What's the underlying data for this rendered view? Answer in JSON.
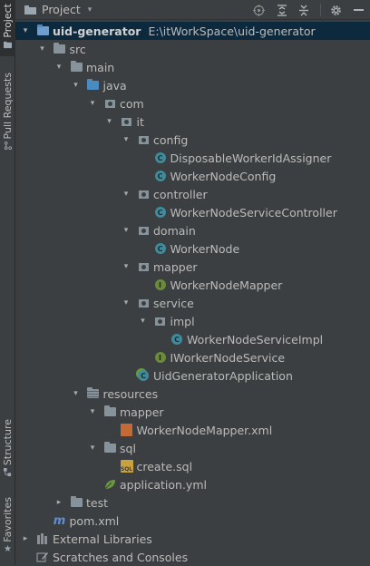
{
  "side_tabs": {
    "project": "Project",
    "pull_requests": "Pull Requests",
    "structure": "Structure",
    "favorites": "Favorites"
  },
  "header": {
    "title": "Project",
    "caret": "▾",
    "icons": [
      "locate-icon",
      "expand-all-icon",
      "collapse-all-icon",
      "settings-icon",
      "hide-icon"
    ]
  },
  "tree": [
    {
      "label": "uid-generator",
      "path": "E:\\itWorkSpace\\uid-generator",
      "depth": 0,
      "state": "open",
      "icon": "module-folder",
      "bold": true,
      "selected": true
    },
    {
      "label": "src",
      "depth": 1,
      "state": "open",
      "icon": "folder"
    },
    {
      "label": "main",
      "depth": 2,
      "state": "open",
      "icon": "folder"
    },
    {
      "label": "java",
      "depth": 3,
      "state": "open",
      "icon": "source-folder"
    },
    {
      "label": "com",
      "depth": 4,
      "state": "open",
      "icon": "package"
    },
    {
      "label": "it",
      "depth": 5,
      "state": "open",
      "icon": "package"
    },
    {
      "label": "config",
      "depth": 6,
      "state": "open",
      "icon": "package"
    },
    {
      "label": "DisposableWorkerIdAssigner",
      "depth": 7,
      "state": "leaf",
      "icon": "class"
    },
    {
      "label": "WorkerNodeConfig",
      "depth": 7,
      "state": "leaf",
      "icon": "class"
    },
    {
      "label": "controller",
      "depth": 6,
      "state": "open",
      "icon": "package"
    },
    {
      "label": "WorkerNodeServiceController",
      "depth": 7,
      "state": "leaf",
      "icon": "class"
    },
    {
      "label": "domain",
      "depth": 6,
      "state": "open",
      "icon": "package"
    },
    {
      "label": "WorkerNode",
      "depth": 7,
      "state": "leaf",
      "icon": "class"
    },
    {
      "label": "mapper",
      "depth": 6,
      "state": "open",
      "icon": "package"
    },
    {
      "label": "WorkerNodeMapper",
      "depth": 7,
      "state": "leaf",
      "icon": "interface"
    },
    {
      "label": "service",
      "depth": 6,
      "state": "open",
      "icon": "package"
    },
    {
      "label": "impl",
      "depth": 7,
      "state": "open",
      "icon": "package"
    },
    {
      "label": "WorkerNodeServiceImpl",
      "depth": 8,
      "state": "leaf",
      "icon": "class"
    },
    {
      "label": "IWorkerNodeService",
      "depth": 7,
      "state": "leaf",
      "icon": "interface"
    },
    {
      "label": "UidGeneratorApplication",
      "depth": 6,
      "state": "leaf",
      "icon": "spring-class"
    },
    {
      "label": "resources",
      "depth": 3,
      "state": "open",
      "icon": "resources-folder"
    },
    {
      "label": "mapper",
      "depth": 4,
      "state": "open",
      "icon": "folder"
    },
    {
      "label": "WorkerNodeMapper.xml",
      "depth": 5,
      "state": "leaf",
      "icon": "xml-file"
    },
    {
      "label": "sql",
      "depth": 4,
      "state": "open",
      "icon": "folder"
    },
    {
      "label": "create.sql",
      "depth": 5,
      "state": "leaf",
      "icon": "sql-file"
    },
    {
      "label": "application.yml",
      "depth": 4,
      "state": "leaf",
      "icon": "yml-file"
    },
    {
      "label": "test",
      "depth": 2,
      "state": "closed",
      "icon": "folder"
    },
    {
      "label": "pom.xml",
      "depth": 1,
      "state": "leaf",
      "icon": "maven-file"
    },
    {
      "label": "External Libraries",
      "depth": 0,
      "state": "closed",
      "icon": "libraries"
    },
    {
      "label": "Scratches and Consoles",
      "depth": 0,
      "state": "leaf",
      "icon": "scratches"
    }
  ],
  "glyphs": {
    "open": "▾",
    "closed": "▸",
    "class": "C",
    "interface": "I",
    "xml": "</>",
    "sql": "SQL",
    "maven": "m"
  }
}
